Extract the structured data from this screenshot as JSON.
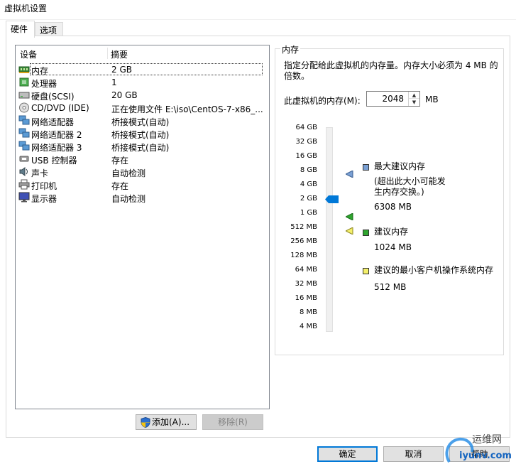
{
  "window": {
    "title": "虚拟机设置"
  },
  "tabs": [
    {
      "label": "硬件"
    },
    {
      "label": "选项"
    }
  ],
  "device_list": {
    "col_device": "设备",
    "col_summary": "摘要",
    "rows": [
      {
        "name": "内存",
        "summary": "2 GB",
        "icon": "memory-icon"
      },
      {
        "name": "处理器",
        "summary": "1",
        "icon": "processor-icon"
      },
      {
        "name": "硬盘(SCSI)",
        "summary": "20 GB",
        "icon": "hard-disk-icon"
      },
      {
        "name": "CD/DVD (IDE)",
        "summary": "正在使用文件 E:\\iso\\CentOS-7-x86_...",
        "icon": "cd-dvd-icon"
      },
      {
        "name": "网络适配器",
        "summary": "桥接模式(自动)",
        "icon": "network-adapter-icon"
      },
      {
        "name": "网络适配器 2",
        "summary": "桥接模式(自动)",
        "icon": "network-adapter-icon"
      },
      {
        "name": "网络适配器 3",
        "summary": "桥接模式(自动)",
        "icon": "network-adapter-icon"
      },
      {
        "name": "USB 控制器",
        "summary": "存在",
        "icon": "usb-icon"
      },
      {
        "name": "声卡",
        "summary": "自动检测",
        "icon": "sound-card-icon"
      },
      {
        "name": "打印机",
        "summary": "存在",
        "icon": "printer-icon"
      },
      {
        "name": "显示器",
        "summary": "自动检测",
        "icon": "display-icon"
      }
    ]
  },
  "buttons": {
    "add": "添加(A)...",
    "remove": "移除(R)",
    "ok": "确定",
    "cancel": "取消",
    "help": "帮助"
  },
  "memory": {
    "group_title": "内存",
    "description": "指定分配给此虚拟机的内存量。内存大小必须为 4 MB 的倍数。",
    "field_label": "此虚拟机的内存(M):",
    "value": "2048",
    "unit": "MB",
    "scale_ticks": [
      "64 GB",
      "32 GB",
      "16 GB",
      "8 GB",
      "4 GB",
      "2 GB",
      "1 GB",
      "512 MB",
      "256 MB",
      "128 MB",
      "64 MB",
      "32 MB",
      "16 MB",
      "8 MB",
      "4 MB"
    ],
    "legend": {
      "max_title": "最大建议内存",
      "max_note": "(超出此大小可能发生内存交换。)",
      "max_value": "6308 MB",
      "rec_title": "建议内存",
      "rec_value": "1024 MB",
      "min_title": "建议的最小客户机操作系统内存",
      "min_value": "512 MB"
    },
    "colors": {
      "max": "#7aa0d4",
      "rec": "#2ea52e",
      "min": "#f4f06a",
      "thumb": "#0078d7"
    }
  },
  "watermark": {
    "text1": "运维网",
    "text2": "iyunv.com"
  }
}
